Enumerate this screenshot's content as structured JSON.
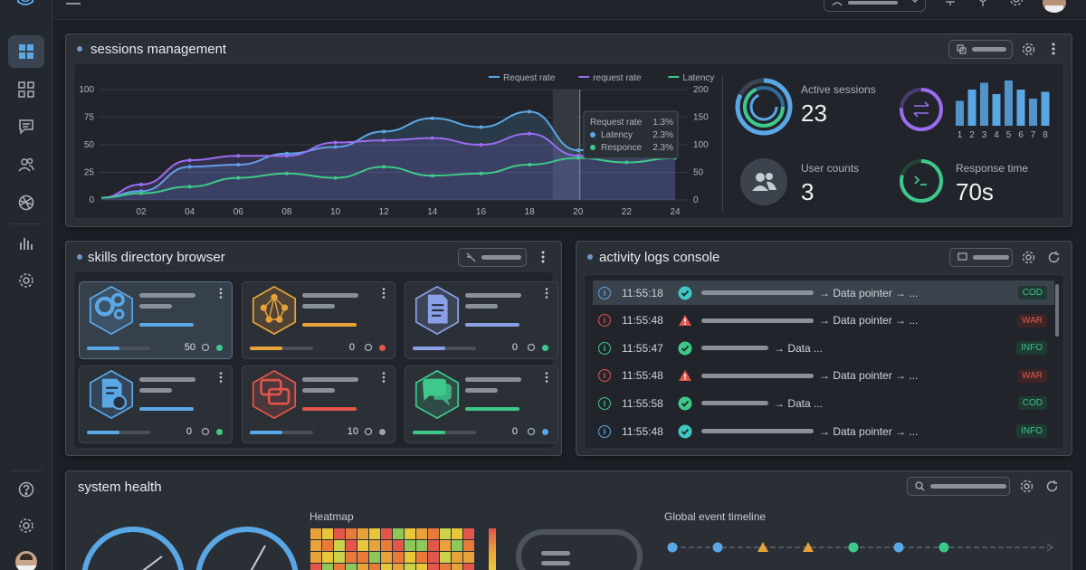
{
  "colors": {
    "accent_blue": "#5aa7e6",
    "accent_purple": "#9b6cf0",
    "accent_green": "#3ec88a",
    "warn_red": "#e2564b",
    "warn_amber": "#e8a23a",
    "bg": "#1c2026",
    "panel": "#2a2f36"
  },
  "sidebar": {
    "items": [
      {
        "icon": "dashboard-icon",
        "active": true
      },
      {
        "icon": "grid-icon"
      },
      {
        "icon": "message-icon"
      },
      {
        "icon": "users-icon"
      },
      {
        "icon": "network-icon"
      },
      {
        "icon": "bar-chart-icon"
      },
      {
        "icon": "settings-icon"
      }
    ],
    "bottom": [
      {
        "icon": "help-icon"
      },
      {
        "icon": "gear-icon"
      },
      {
        "icon": "avatar"
      }
    ]
  },
  "sessions": {
    "title": "sessions management",
    "chart_data": {
      "type": "line",
      "x": [
        "02",
        "04",
        "06",
        "08",
        "10",
        "12",
        "14",
        "16",
        "18",
        "20",
        "22",
        "24"
      ],
      "series": [
        {
          "name": "Request rate",
          "color": "#5aa7e6",
          "values": [
            8,
            30,
            32,
            42,
            48,
            62,
            74,
            66,
            80,
            45,
            58,
            76
          ]
        },
        {
          "name": "request rate",
          "color": "#9b6cf0",
          "values": [
            14,
            36,
            40,
            40,
            52,
            54,
            56,
            50,
            60,
            40,
            48,
            52
          ]
        },
        {
          "name": "Latency",
          "color": "#3ec88a",
          "values": [
            6,
            12,
            20,
            24,
            20,
            30,
            22,
            24,
            32,
            38,
            34,
            38
          ]
        }
      ],
      "ylim_left": [
        0,
        100
      ],
      "ylim_right": [
        0,
        200
      ],
      "yticks_left": [
        "100",
        "75",
        "50",
        "25",
        "0"
      ],
      "yticks_right": [
        "200",
        "150",
        "100",
        "50",
        "0"
      ],
      "legend": "top-right"
    },
    "tooltip": {
      "rows": [
        {
          "label": "Request rate",
          "value": "1.3%",
          "bullet": ""
        },
        {
          "label": "Latency",
          "value": "2.3%",
          "bullet": "#5aa7e6"
        },
        {
          "label": "Responce",
          "value": "2.3%",
          "bullet": "#3ec88a"
        }
      ]
    },
    "stats": {
      "active_sessions": {
        "label": "Active sessions",
        "value": "23"
      },
      "user_counts": {
        "label": "User counts",
        "value": "3"
      },
      "response_time": {
        "label": "Response time",
        "value": "70s"
      }
    },
    "mini_bars": {
      "categories": [
        "1",
        "2",
        "3",
        "4",
        "5",
        "6",
        "7",
        "8"
      ],
      "values": [
        55,
        80,
        95,
        70,
        100,
        80,
        60,
        75
      ]
    }
  },
  "skills": {
    "title": "skills directory browser",
    "cards": [
      {
        "icon": "gears-icon",
        "count": "50",
        "color": "#5aa7e6",
        "status": "#3ec88a",
        "meta": "bar-chart-icon",
        "active": true
      },
      {
        "icon": "network-graph-icon",
        "count": "0",
        "color": "#e8a23a",
        "status": "#e2564b",
        "meta": "share-icon"
      },
      {
        "icon": "document-icon",
        "count": "0",
        "color": "#8aa0e6",
        "status": "#3ec88a",
        "meta": "share-icon"
      },
      {
        "icon": "verified-document-icon",
        "count": "0",
        "color": "#5aa7e6",
        "status": "#3ec88a",
        "meta": "user-icon"
      },
      {
        "icon": "chat-bubbles-icon",
        "count": "10",
        "color": "#e2564b",
        "status": "#9aa2ab",
        "meta": "pie-icon"
      },
      {
        "icon": "chat-icon",
        "count": "0",
        "color": "#3ec88a",
        "status": "#5aa7e6",
        "meta": "globe-icon"
      }
    ]
  },
  "activity": {
    "title": "activity logs console",
    "rows": [
      {
        "time": "11:55:18",
        "level": "info",
        "status": "check",
        "text": "→ Data pointer → ...",
        "badge": "COD",
        "kind": "cod",
        "selected": true
      },
      {
        "time": "11:55:48",
        "level": "error",
        "status": "warn",
        "text": "→ Data pointer → ...",
        "badge": "WAR",
        "kind": "war"
      },
      {
        "time": "11:55:47",
        "level": "ok",
        "status": "check",
        "text": "→ Data ...",
        "badge": "INFO",
        "kind": "info"
      },
      {
        "time": "11:55:48",
        "level": "error",
        "status": "warn",
        "text": "→ Data pointer → ...",
        "badge": "WAR",
        "kind": "war"
      },
      {
        "time": "11:55:58",
        "level": "ok",
        "status": "check",
        "text": "→ Data ...",
        "badge": "COD",
        "kind": "cod"
      },
      {
        "time": "11:55:48",
        "level": "info",
        "status": "check",
        "text": "→ Data pointer → ...",
        "badge": "INFO",
        "kind": "info"
      }
    ]
  },
  "health": {
    "title": "system health",
    "heatmap_label": "Heatmap",
    "timeline_label": "Global event timeline",
    "timeline_events": [
      "blue",
      "blue",
      "amber",
      "amber",
      "green",
      "blue",
      "green"
    ]
  }
}
